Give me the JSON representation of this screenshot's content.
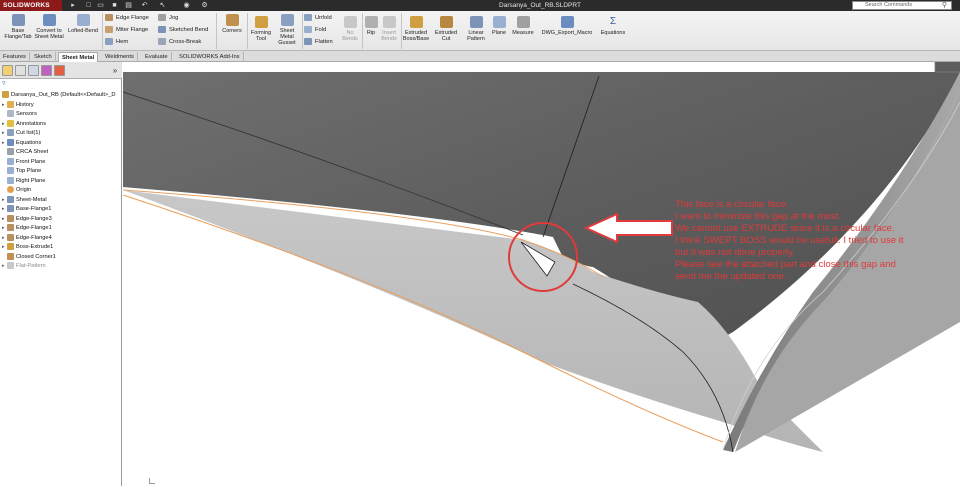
{
  "app": {
    "brand": "SOLIDWORKS",
    "document_title": "Darsanya_Out_RB.SLDPRT",
    "search_placeholder": "Search Commands"
  },
  "quick_access": [
    "new-icon",
    "open-icon",
    "save-icon",
    "print-icon",
    "undo-icon",
    "select-icon",
    "rebuild-icon",
    "options-icon"
  ],
  "ribbon": {
    "base_flange": "Base Flange/Tab",
    "convert_to_sheet_metal": "Convert to Sheet Metal",
    "lofted_bend": "Lofted-Bend",
    "edge_flange": "Edge Flange",
    "miter_flange": "Miter Flange",
    "hem": "Hem",
    "jog": "Jog",
    "sketched_bend": "Sketched Bend",
    "cross_break": "Cross-Break",
    "corners": "Corners",
    "forming_tool": "Forming Tool",
    "sheet_metal_gusset": "Sheet Metal Gusset",
    "unfold": "Unfold",
    "fold": "Fold",
    "flatten": "Flatten",
    "no_bends": "No Bends",
    "rip": "Rip",
    "insert_bends": "Insert Bends",
    "extruded_boss_base": "Extruded Boss/Base",
    "extruded_cut": "Extruded Cut",
    "linear_pattern": "Linear Pattern",
    "plane": "Plane",
    "measure": "Measure",
    "dwg_export_macro": "DWG_Export_Macro",
    "equations": "Equations"
  },
  "command_tabs": [
    "Features",
    "Sketch",
    "Sheet Metal",
    "Weldments",
    "Evaluate",
    "SOLIDWORKS Add-Ins"
  ],
  "active_command_tab": "Sheet Metal",
  "feature_tree": {
    "root": "Darsanya_Out_RB  (Default<<Default>_D",
    "items": [
      "History",
      "Sensors",
      "Annotations",
      "Cut list(1)",
      "Equations",
      "CRCA Sheet",
      "Front Plane",
      "Top Plane",
      "Right Plane",
      "Origin",
      "Sheet-Metal",
      "Base-Flange1",
      "Edge-Flange3",
      "Edge-Flange1",
      "Edge-Flange4",
      "Boss-Extrude1",
      "Closed Corner1",
      "Flat-Pattern"
    ]
  },
  "annotation": {
    "color": "#e03a3a",
    "lines": [
      "This face is a circular face.",
      "I want to minimize this gap at the most.",
      "We cannot use EXTRUDE since it is a circular face.",
      "I think SWEPT BOSS would be usefull. I tried to use it",
      "but it was not done properly.",
      "Please see the attached part and close this gap and",
      "send me the updated one."
    ]
  },
  "colors": {
    "brand": "#8b1a1a",
    "highlight_edge": "#e8a060",
    "annotation": "#e03a3a"
  }
}
